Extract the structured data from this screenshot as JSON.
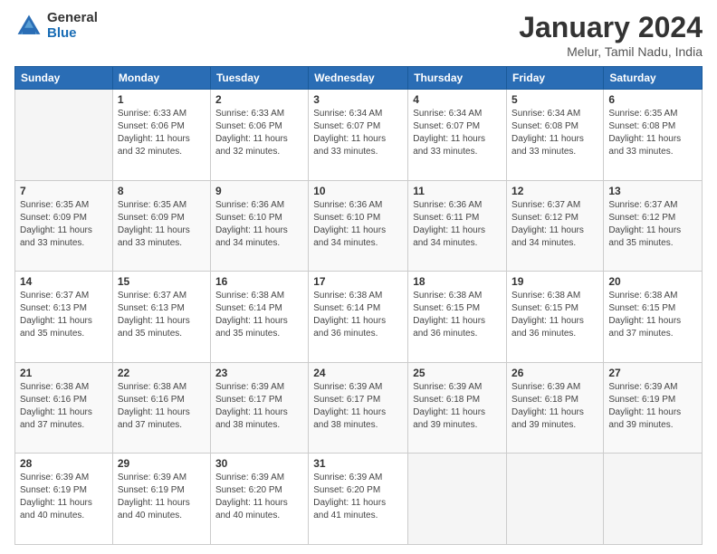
{
  "logo": {
    "line1": "General",
    "line2": "Blue"
  },
  "title": "January 2024",
  "subtitle": "Melur, Tamil Nadu, India",
  "header_days": [
    "Sunday",
    "Monday",
    "Tuesday",
    "Wednesday",
    "Thursday",
    "Friday",
    "Saturday"
  ],
  "weeks": [
    [
      {
        "day": "",
        "sunrise": "",
        "sunset": "",
        "daylight": ""
      },
      {
        "day": "1",
        "sunrise": "Sunrise: 6:33 AM",
        "sunset": "Sunset: 6:06 PM",
        "daylight": "Daylight: 11 hours and 32 minutes."
      },
      {
        "day": "2",
        "sunrise": "Sunrise: 6:33 AM",
        "sunset": "Sunset: 6:06 PM",
        "daylight": "Daylight: 11 hours and 32 minutes."
      },
      {
        "day": "3",
        "sunrise": "Sunrise: 6:34 AM",
        "sunset": "Sunset: 6:07 PM",
        "daylight": "Daylight: 11 hours and 33 minutes."
      },
      {
        "day": "4",
        "sunrise": "Sunrise: 6:34 AM",
        "sunset": "Sunset: 6:07 PM",
        "daylight": "Daylight: 11 hours and 33 minutes."
      },
      {
        "day": "5",
        "sunrise": "Sunrise: 6:34 AM",
        "sunset": "Sunset: 6:08 PM",
        "daylight": "Daylight: 11 hours and 33 minutes."
      },
      {
        "day": "6",
        "sunrise": "Sunrise: 6:35 AM",
        "sunset": "Sunset: 6:08 PM",
        "daylight": "Daylight: 11 hours and 33 minutes."
      }
    ],
    [
      {
        "day": "7",
        "sunrise": "Sunrise: 6:35 AM",
        "sunset": "Sunset: 6:09 PM",
        "daylight": "Daylight: 11 hours and 33 minutes."
      },
      {
        "day": "8",
        "sunrise": "Sunrise: 6:35 AM",
        "sunset": "Sunset: 6:09 PM",
        "daylight": "Daylight: 11 hours and 33 minutes."
      },
      {
        "day": "9",
        "sunrise": "Sunrise: 6:36 AM",
        "sunset": "Sunset: 6:10 PM",
        "daylight": "Daylight: 11 hours and 34 minutes."
      },
      {
        "day": "10",
        "sunrise": "Sunrise: 6:36 AM",
        "sunset": "Sunset: 6:10 PM",
        "daylight": "Daylight: 11 hours and 34 minutes."
      },
      {
        "day": "11",
        "sunrise": "Sunrise: 6:36 AM",
        "sunset": "Sunset: 6:11 PM",
        "daylight": "Daylight: 11 hours and 34 minutes."
      },
      {
        "day": "12",
        "sunrise": "Sunrise: 6:37 AM",
        "sunset": "Sunset: 6:12 PM",
        "daylight": "Daylight: 11 hours and 34 minutes."
      },
      {
        "day": "13",
        "sunrise": "Sunrise: 6:37 AM",
        "sunset": "Sunset: 6:12 PM",
        "daylight": "Daylight: 11 hours and 35 minutes."
      }
    ],
    [
      {
        "day": "14",
        "sunrise": "Sunrise: 6:37 AM",
        "sunset": "Sunset: 6:13 PM",
        "daylight": "Daylight: 11 hours and 35 minutes."
      },
      {
        "day": "15",
        "sunrise": "Sunrise: 6:37 AM",
        "sunset": "Sunset: 6:13 PM",
        "daylight": "Daylight: 11 hours and 35 minutes."
      },
      {
        "day": "16",
        "sunrise": "Sunrise: 6:38 AM",
        "sunset": "Sunset: 6:14 PM",
        "daylight": "Daylight: 11 hours and 35 minutes."
      },
      {
        "day": "17",
        "sunrise": "Sunrise: 6:38 AM",
        "sunset": "Sunset: 6:14 PM",
        "daylight": "Daylight: 11 hours and 36 minutes."
      },
      {
        "day": "18",
        "sunrise": "Sunrise: 6:38 AM",
        "sunset": "Sunset: 6:15 PM",
        "daylight": "Daylight: 11 hours and 36 minutes."
      },
      {
        "day": "19",
        "sunrise": "Sunrise: 6:38 AM",
        "sunset": "Sunset: 6:15 PM",
        "daylight": "Daylight: 11 hours and 36 minutes."
      },
      {
        "day": "20",
        "sunrise": "Sunrise: 6:38 AM",
        "sunset": "Sunset: 6:15 PM",
        "daylight": "Daylight: 11 hours and 37 minutes."
      }
    ],
    [
      {
        "day": "21",
        "sunrise": "Sunrise: 6:38 AM",
        "sunset": "Sunset: 6:16 PM",
        "daylight": "Daylight: 11 hours and 37 minutes."
      },
      {
        "day": "22",
        "sunrise": "Sunrise: 6:38 AM",
        "sunset": "Sunset: 6:16 PM",
        "daylight": "Daylight: 11 hours and 37 minutes."
      },
      {
        "day": "23",
        "sunrise": "Sunrise: 6:39 AM",
        "sunset": "Sunset: 6:17 PM",
        "daylight": "Daylight: 11 hours and 38 minutes."
      },
      {
        "day": "24",
        "sunrise": "Sunrise: 6:39 AM",
        "sunset": "Sunset: 6:17 PM",
        "daylight": "Daylight: 11 hours and 38 minutes."
      },
      {
        "day": "25",
        "sunrise": "Sunrise: 6:39 AM",
        "sunset": "Sunset: 6:18 PM",
        "daylight": "Daylight: 11 hours and 39 minutes."
      },
      {
        "day": "26",
        "sunrise": "Sunrise: 6:39 AM",
        "sunset": "Sunset: 6:18 PM",
        "daylight": "Daylight: 11 hours and 39 minutes."
      },
      {
        "day": "27",
        "sunrise": "Sunrise: 6:39 AM",
        "sunset": "Sunset: 6:19 PM",
        "daylight": "Daylight: 11 hours and 39 minutes."
      }
    ],
    [
      {
        "day": "28",
        "sunrise": "Sunrise: 6:39 AM",
        "sunset": "Sunset: 6:19 PM",
        "daylight": "Daylight: 11 hours and 40 minutes."
      },
      {
        "day": "29",
        "sunrise": "Sunrise: 6:39 AM",
        "sunset": "Sunset: 6:19 PM",
        "daylight": "Daylight: 11 hours and 40 minutes."
      },
      {
        "day": "30",
        "sunrise": "Sunrise: 6:39 AM",
        "sunset": "Sunset: 6:20 PM",
        "daylight": "Daylight: 11 hours and 40 minutes."
      },
      {
        "day": "31",
        "sunrise": "Sunrise: 6:39 AM",
        "sunset": "Sunset: 6:20 PM",
        "daylight": "Daylight: 11 hours and 41 minutes."
      },
      {
        "day": "",
        "sunrise": "",
        "sunset": "",
        "daylight": ""
      },
      {
        "day": "",
        "sunrise": "",
        "sunset": "",
        "daylight": ""
      },
      {
        "day": "",
        "sunrise": "",
        "sunset": "",
        "daylight": ""
      }
    ]
  ]
}
